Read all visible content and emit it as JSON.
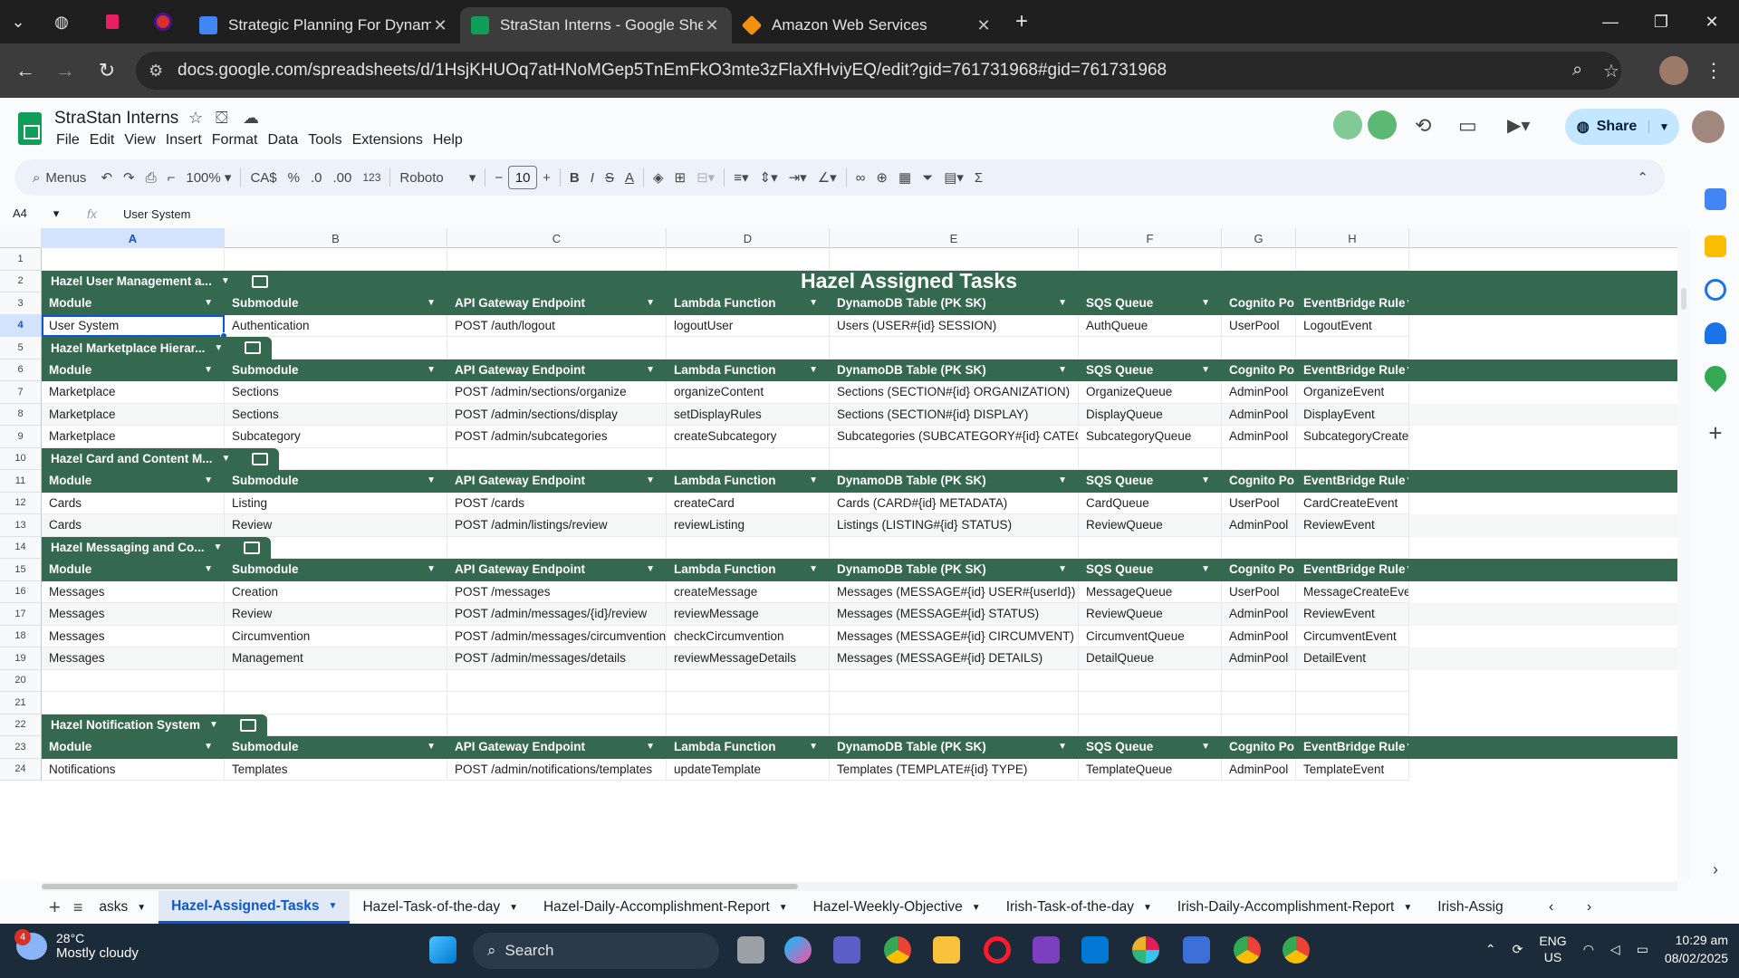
{
  "browser": {
    "tabs": [
      {
        "title": "Strategic Planning For Dynamic",
        "favicon_color": "#4285f4",
        "active": false
      },
      {
        "title": "StraStan Interns - Google Sheet",
        "favicon_color": "#0f9d58",
        "active": true
      },
      {
        "title": "Amazon Web Services",
        "favicon_color": "#f29111",
        "active": false
      }
    ],
    "url": "docs.google.com/spreadsheets/d/1HsjKHUOq7atHNoMGep5TnEmFkO3mte3zFlaXfHviyEQ/edit?gid=761731968#gid=761731968"
  },
  "doc": {
    "title": "StraStan Interns",
    "menus": [
      "File",
      "Edit",
      "View",
      "Insert",
      "Format",
      "Data",
      "Tools",
      "Extensions",
      "Help"
    ],
    "share_label": "Share"
  },
  "toolbar": {
    "menus_label": "Menus",
    "zoom": "100%",
    "currency": "CA$",
    "percent": "%",
    "dec_decrease": ".0",
    "dec_increase": ".00",
    "number_format": "123",
    "font": "Roboto",
    "font_size": "10",
    "bold": "B",
    "italic": "I",
    "strike": "S",
    "text_color": "A"
  },
  "formula_bar": {
    "name_box": "A4",
    "fx": "fx",
    "content": "User System"
  },
  "columns": [
    "A",
    "B",
    "C",
    "D",
    "E",
    "F",
    "G",
    "H"
  ],
  "rows": [
    {
      "n": "1"
    },
    {
      "n": "2"
    },
    {
      "n": "3"
    },
    {
      "n": "4"
    },
    {
      "n": "5"
    },
    {
      "n": "6"
    },
    {
      "n": "7"
    },
    {
      "n": "8"
    },
    {
      "n": "9"
    },
    {
      "n": "10"
    },
    {
      "n": "11"
    },
    {
      "n": "12"
    },
    {
      "n": "13"
    },
    {
      "n": "14"
    },
    {
      "n": "15"
    },
    {
      "n": "16"
    },
    {
      "n": "17"
    },
    {
      "n": "18"
    },
    {
      "n": "19"
    },
    {
      "n": "20"
    },
    {
      "n": "21"
    },
    {
      "n": "22"
    },
    {
      "n": "23"
    },
    {
      "n": "24"
    }
  ],
  "sheet": {
    "main_title": "Hazel Assigned Tasks",
    "header": [
      "Module",
      "Submodule",
      "API Gateway Endpoint",
      "Lambda Function",
      "DynamoDB Table (PK SK)",
      "SQS Queue",
      "Cognito Po",
      "EventBridge Rule"
    ],
    "tables": [
      {
        "name": "Hazel User Management a...",
        "rows": [
          [
            "User System",
            "Authentication",
            "POST /auth/logout",
            "logoutUser",
            "Users (USER#{id} SESSION)",
            "AuthQueue",
            "UserPool",
            "LogoutEvent"
          ]
        ]
      },
      {
        "name": "Hazel Marketplace Hierar...",
        "rows": [
          [
            "Marketplace",
            "Sections",
            "POST /admin/sections/organize",
            "organizeContent",
            "Sections (SECTION#{id} ORGANIZATION)",
            "OrganizeQueue",
            "AdminPool",
            "OrganizeEvent"
          ],
          [
            "Marketplace",
            "Sections",
            "POST /admin/sections/display",
            "setDisplayRules",
            "Sections (SECTION#{id} DISPLAY)",
            "DisplayQueue",
            "AdminPool",
            "DisplayEvent"
          ],
          [
            "Marketplace",
            "Subcategory",
            "POST /admin/subcategories",
            "createSubcategory",
            "Subcategories (SUBCATEGORY#{id} CATEGORY#{categ",
            "SubcategoryQueue",
            "AdminPool",
            "SubcategoryCreateEvent"
          ]
        ]
      },
      {
        "name": "Hazel Card and Content M...",
        "rows": [
          [
            "Cards",
            "Listing",
            "POST /cards",
            "createCard",
            "Cards (CARD#{id} METADATA)",
            "CardQueue",
            "UserPool",
            "CardCreateEvent"
          ],
          [
            "Cards",
            "Review",
            "POST /admin/listings/review",
            "reviewListing",
            "Listings (LISTING#{id} STATUS)",
            "ReviewQueue",
            "AdminPool",
            "ReviewEvent"
          ]
        ]
      },
      {
        "name": "Hazel Messaging and Co...",
        "rows": [
          [
            "Messages",
            "Creation",
            "POST /messages",
            "createMessage",
            "Messages (MESSAGE#{id} USER#{userId})",
            "MessageQueue",
            "UserPool",
            "MessageCreateEvent"
          ],
          [
            "Messages",
            "Review",
            "POST /admin/messages/{id}/review",
            "reviewMessage",
            "Messages (MESSAGE#{id} STATUS)",
            "ReviewQueue",
            "AdminPool",
            "ReviewEvent"
          ],
          [
            "Messages",
            "Circumvention",
            "POST /admin/messages/circumvention",
            "checkCircumvention",
            "Messages (MESSAGE#{id} CIRCUMVENT)",
            "CircumventQueue",
            "AdminPool",
            "CircumventEvent"
          ],
          [
            "Messages",
            "Management",
            "POST /admin/messages/details",
            "reviewMessageDetails",
            "Messages (MESSAGE#{id} DETAILS)",
            "DetailQueue",
            "AdminPool",
            "DetailEvent"
          ]
        ]
      },
      {
        "name": "Hazel Notification System",
        "rows": [
          [
            "Notifications",
            "Templates",
            "POST /admin/notifications/templates",
            "updateTemplate",
            "Templates (TEMPLATE#{id} TYPE)",
            "TemplateQueue",
            "AdminPool",
            "TemplateEvent"
          ]
        ]
      }
    ]
  },
  "sheet_tabs": [
    "asks",
    "Hazel-Assigned-Tasks",
    "Hazel-Task-of-the-day",
    "Hazel-Daily-Accomplishment-Report",
    "Hazel-Weekly-Objective",
    "Irish-Task-of-the-day",
    "Irish-Daily-Accomplishment-Report",
    "Irish-Assig"
  ],
  "taskbar": {
    "weather_badge": "4",
    "temperature": "28°C",
    "condition": "Mostly cloudy",
    "search_label": "Search",
    "lang1": "ENG",
    "lang2": "US",
    "time": "10:29 am",
    "date": "08/02/2025"
  },
  "colors": {
    "accent": "#34694f",
    "selection": "#0b57d0"
  }
}
